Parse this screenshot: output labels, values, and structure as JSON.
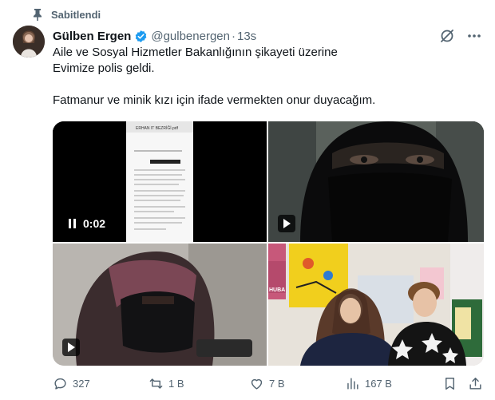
{
  "pinned": {
    "label": "Sabitlendi",
    "icon": "pin-icon"
  },
  "author": {
    "name": "Gülben Ergen",
    "handle": "@gulbenergen",
    "separator": "·",
    "time": "13s",
    "verified_color": "#1d9bf0"
  },
  "tweet": {
    "line1": "Aile ve Sosyal Hizmetler Bakanlığının şikayeti üzerine",
    "line2": "Evimize polis geldi.",
    "line3": "Fatmanur ve minik kızı için ifade vermekten onur duyacağım."
  },
  "media": {
    "video_duration": "0:02",
    "document_title": "ERHAN IT BEZRİĞİ.pdf",
    "poster_text": "HUBA"
  },
  "actions": {
    "replies": "327",
    "reposts": "1 B",
    "likes": "7 B",
    "views": "167 B"
  },
  "colors": {
    "muted": "#536471",
    "text": "#0f1419",
    "accent": "#1d9bf0"
  }
}
